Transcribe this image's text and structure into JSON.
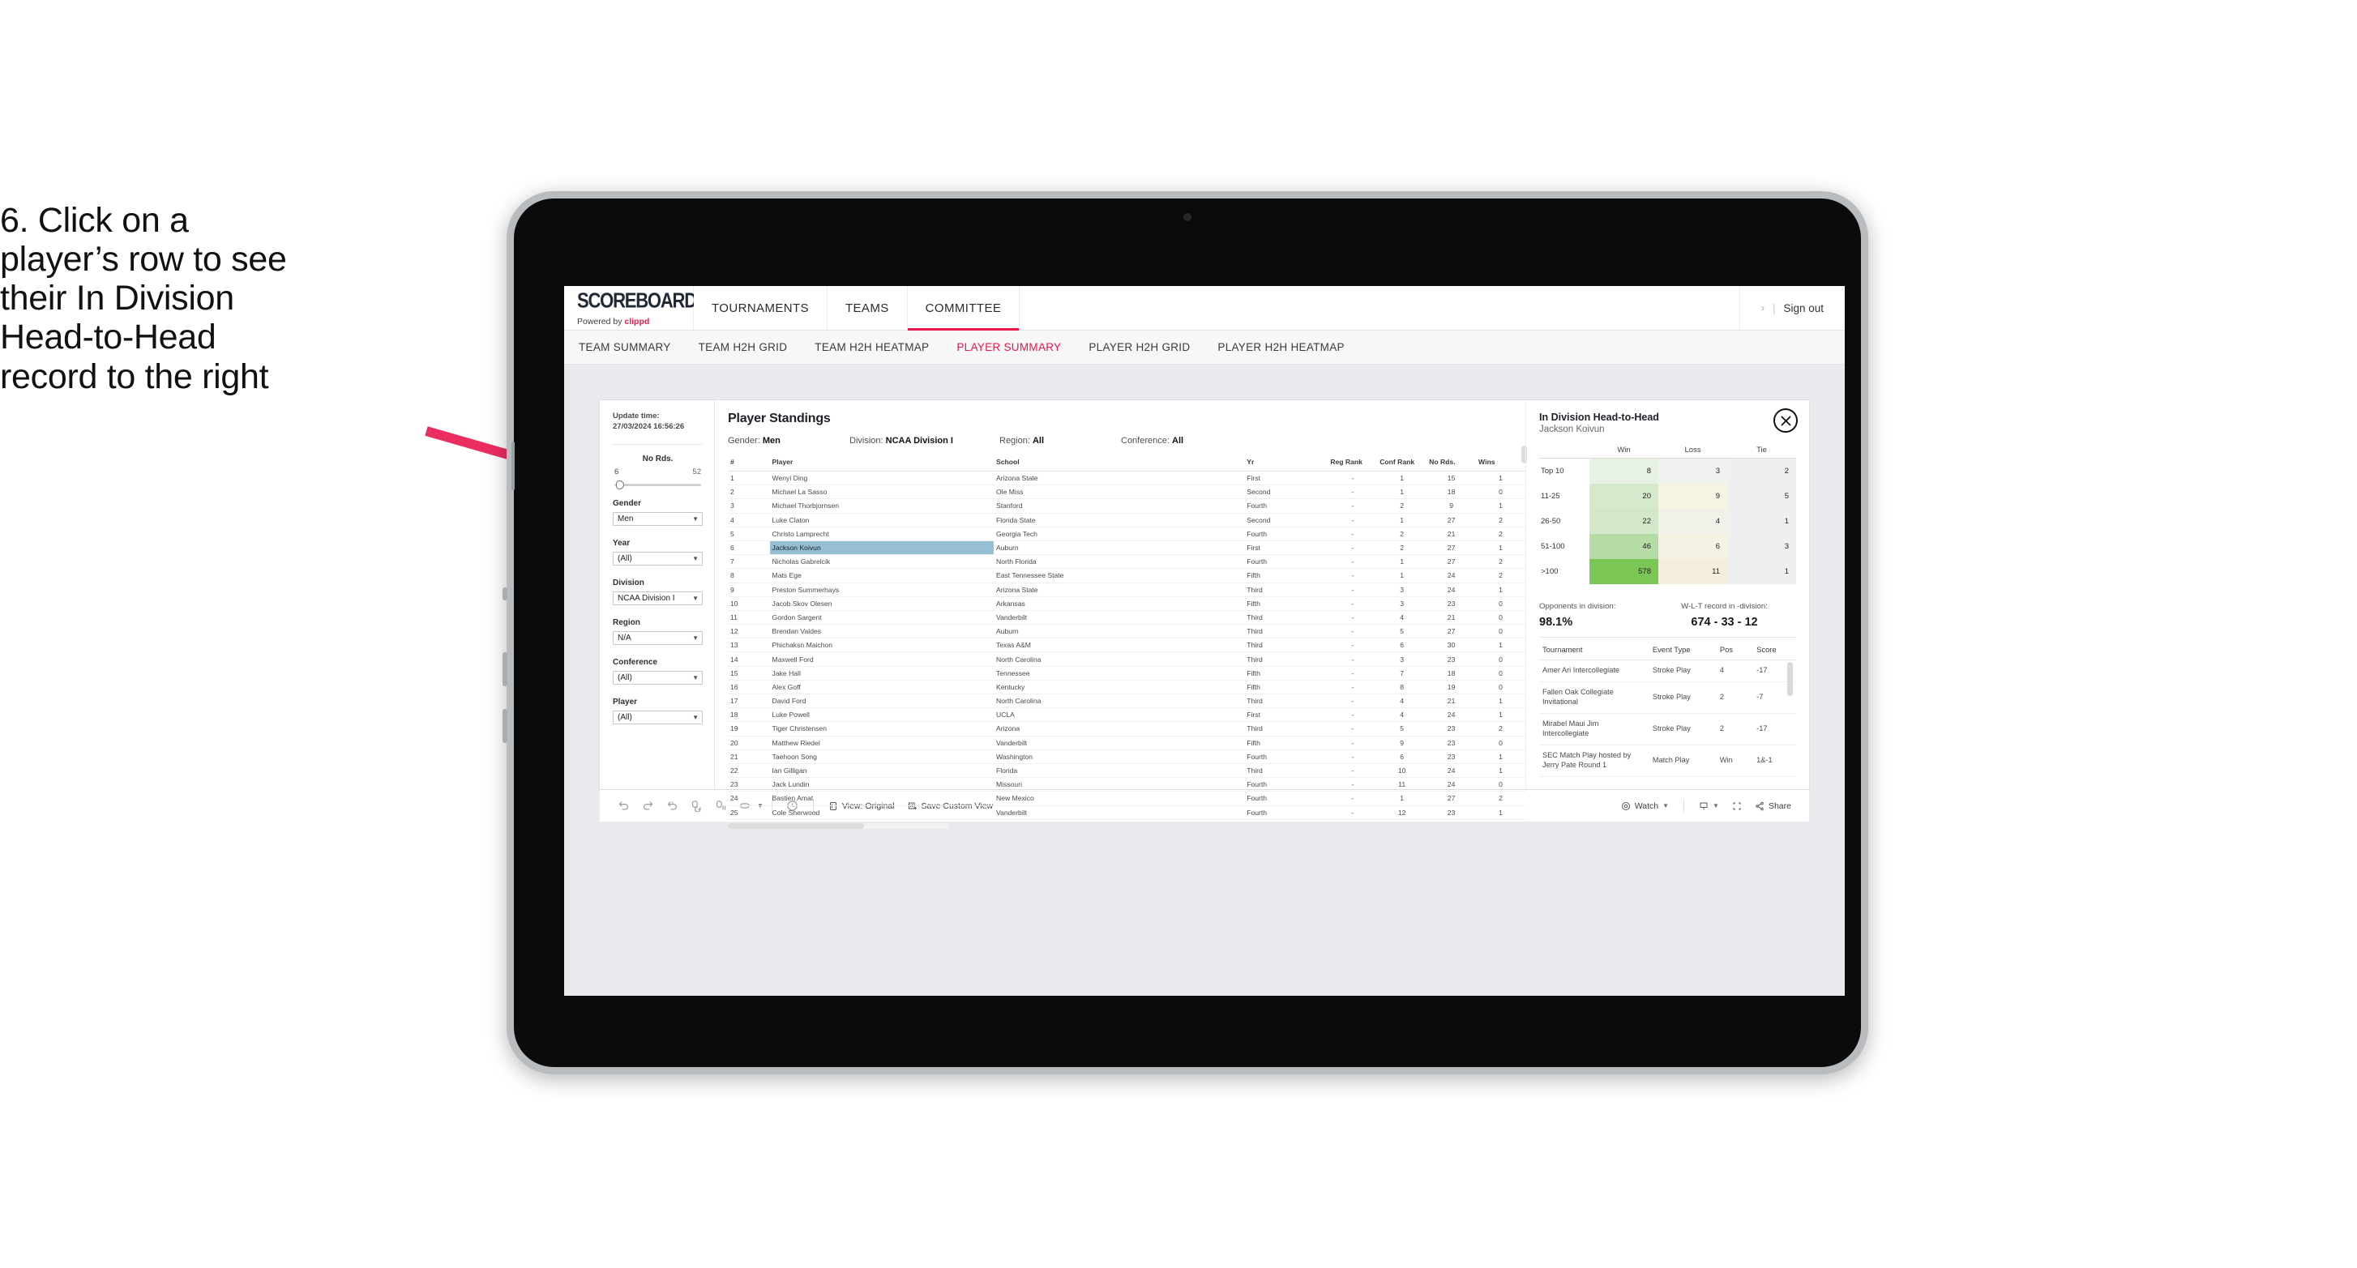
{
  "callout": {
    "lines": [
      "6. Click on a",
      "player’s row to see",
      "their In Division",
      "Head-to-Head",
      "record to the right"
    ]
  },
  "appbar": {
    "logo_main": "SCOREBOARD",
    "logo_sub_prefix": "Powered by ",
    "logo_sub_brand": "clippd",
    "nav": [
      {
        "label": "TOURNAMENTS",
        "active": false
      },
      {
        "label": "TEAMS",
        "active": false
      },
      {
        "label": "COMMITTEE",
        "active": true
      }
    ],
    "chevron": "›",
    "divider": "|",
    "sign_out": "Sign out"
  },
  "subnav": {
    "items": [
      {
        "label": "TEAM SUMMARY",
        "active": false
      },
      {
        "label": "TEAM H2H GRID",
        "active": false
      },
      {
        "label": "TEAM H2H HEATMAP",
        "active": false
      },
      {
        "label": "PLAYER SUMMARY",
        "active": true
      },
      {
        "label": "PLAYER H2H GRID",
        "active": false
      },
      {
        "label": "PLAYER H2H HEATMAP",
        "active": false
      }
    ]
  },
  "filters": {
    "update_label": "Update time:",
    "update_value": "27/03/2024 16:56:26",
    "slider": {
      "title": "No Rds.",
      "min": "6",
      "max": "52"
    },
    "selects": [
      {
        "title": "Gender",
        "value": "Men"
      },
      {
        "title": "Year",
        "value": "(All)"
      },
      {
        "title": "Division",
        "value": "NCAA Division I"
      },
      {
        "title": "Region",
        "value": "N/A"
      },
      {
        "title": "Conference",
        "value": "(All)"
      },
      {
        "title": "Player",
        "value": "(All)"
      }
    ]
  },
  "standings": {
    "title": "Player Standings",
    "meta": [
      {
        "label": "Gender:",
        "value": "Men"
      },
      {
        "label": "Division:",
        "value": "NCAA Division I"
      },
      {
        "label": "Region:",
        "value": "All"
      },
      {
        "label": "Conference:",
        "value": "All"
      }
    ],
    "columns": [
      "#",
      "Player",
      "School",
      "Yr",
      "Reg Rank",
      "Conf Rank",
      "No Rds.",
      "Wins"
    ],
    "rows": [
      {
        "n": "1",
        "player": "Wenyi Ding",
        "school": "Arizona State",
        "yr": "First",
        "reg": "-",
        "conf": "1",
        "rds": "15",
        "wins": "1",
        "selected": false
      },
      {
        "n": "2",
        "player": "Michael La Sasso",
        "school": "Ole Miss",
        "yr": "Second",
        "reg": "-",
        "conf": "1",
        "rds": "18",
        "wins": "0",
        "selected": false
      },
      {
        "n": "3",
        "player": "Michael Thorbjornsen",
        "school": "Stanford",
        "yr": "Fourth",
        "reg": "-",
        "conf": "2",
        "rds": "9",
        "wins": "1",
        "selected": false
      },
      {
        "n": "4",
        "player": "Luke Claton",
        "school": "Florida State",
        "yr": "Second",
        "reg": "-",
        "conf": "1",
        "rds": "27",
        "wins": "2",
        "selected": false
      },
      {
        "n": "5",
        "player": "Christo Lamprecht",
        "school": "Georgia Tech",
        "yr": "Fourth",
        "reg": "-",
        "conf": "2",
        "rds": "21",
        "wins": "2",
        "selected": false
      },
      {
        "n": "6",
        "player": "Jackson Koivun",
        "school": "Auburn",
        "yr": "First",
        "reg": "-",
        "conf": "2",
        "rds": "27",
        "wins": "1",
        "selected": true
      },
      {
        "n": "7",
        "player": "Nicholas Gabrelcik",
        "school": "North Florida",
        "yr": "Fourth",
        "reg": "-",
        "conf": "1",
        "rds": "27",
        "wins": "2",
        "selected": false
      },
      {
        "n": "8",
        "player": "Mats Ege",
        "school": "East Tennessee State",
        "yr": "Fifth",
        "reg": "-",
        "conf": "1",
        "rds": "24",
        "wins": "2",
        "selected": false
      },
      {
        "n": "9",
        "player": "Preston Summerhays",
        "school": "Arizona State",
        "yr": "Third",
        "reg": "-",
        "conf": "3",
        "rds": "24",
        "wins": "1",
        "selected": false
      },
      {
        "n": "10",
        "player": "Jacob Skov Olesen",
        "school": "Arkansas",
        "yr": "Fifth",
        "reg": "-",
        "conf": "3",
        "rds": "23",
        "wins": "0",
        "selected": false
      },
      {
        "n": "11",
        "player": "Gordon Sargent",
        "school": "Vanderbilt",
        "yr": "Third",
        "reg": "-",
        "conf": "4",
        "rds": "21",
        "wins": "0",
        "selected": false
      },
      {
        "n": "12",
        "player": "Brendan Valdes",
        "school": "Auburn",
        "yr": "Third",
        "reg": "-",
        "conf": "5",
        "rds": "27",
        "wins": "0",
        "selected": false
      },
      {
        "n": "13",
        "player": "Phichaksn Maichon",
        "school": "Texas A&M",
        "yr": "Third",
        "reg": "-",
        "conf": "6",
        "rds": "30",
        "wins": "1",
        "selected": false
      },
      {
        "n": "14",
        "player": "Maxwell Ford",
        "school": "North Carolina",
        "yr": "Third",
        "reg": "-",
        "conf": "3",
        "rds": "23",
        "wins": "0",
        "selected": false
      },
      {
        "n": "15",
        "player": "Jake Hall",
        "school": "Tennessee",
        "yr": "Fifth",
        "reg": "-",
        "conf": "7",
        "rds": "18",
        "wins": "0",
        "selected": false
      },
      {
        "n": "16",
        "player": "Alex Goff",
        "school": "Kentucky",
        "yr": "Fifth",
        "reg": "-",
        "conf": "8",
        "rds": "19",
        "wins": "0",
        "selected": false
      },
      {
        "n": "17",
        "player": "David Ford",
        "school": "North Carolina",
        "yr": "Third",
        "reg": "-",
        "conf": "4",
        "rds": "21",
        "wins": "1",
        "selected": false
      },
      {
        "n": "18",
        "player": "Luke Powell",
        "school": "UCLA",
        "yr": "First",
        "reg": "-",
        "conf": "4",
        "rds": "24",
        "wins": "1",
        "selected": false
      },
      {
        "n": "19",
        "player": "Tiger Christensen",
        "school": "Arizona",
        "yr": "Third",
        "reg": "-",
        "conf": "5",
        "rds": "23",
        "wins": "2",
        "selected": false
      },
      {
        "n": "20",
        "player": "Matthew Riedel",
        "school": "Vanderbilt",
        "yr": "Fifth",
        "reg": "-",
        "conf": "9",
        "rds": "23",
        "wins": "0",
        "selected": false
      },
      {
        "n": "21",
        "player": "Taehoon Song",
        "school": "Washington",
        "yr": "Fourth",
        "reg": "-",
        "conf": "6",
        "rds": "23",
        "wins": "1",
        "selected": false
      },
      {
        "n": "22",
        "player": "Ian Gilligan",
        "school": "Florida",
        "yr": "Third",
        "reg": "-",
        "conf": "10",
        "rds": "24",
        "wins": "1",
        "selected": false
      },
      {
        "n": "23",
        "player": "Jack Lundin",
        "school": "Missouri",
        "yr": "Fourth",
        "reg": "-",
        "conf": "11",
        "rds": "24",
        "wins": "0",
        "selected": false
      },
      {
        "n": "24",
        "player": "Bastien Amat",
        "school": "New Mexico",
        "yr": "Fourth",
        "reg": "-",
        "conf": "1",
        "rds": "27",
        "wins": "2",
        "selected": false
      },
      {
        "n": "25",
        "player": "Cole Sherwood",
        "school": "Vanderbilt",
        "yr": "Fourth",
        "reg": "-",
        "conf": "12",
        "rds": "23",
        "wins": "1",
        "selected": false
      }
    ]
  },
  "h2h": {
    "title": "In Division Head-to-Head",
    "player": "Jackson Koivun",
    "close_icon": "close-icon",
    "heatmap": {
      "columns": [
        "Win",
        "Loss",
        "Tie"
      ],
      "rows": [
        {
          "label": "Top 10",
          "win": "8",
          "loss": "3",
          "tie": "2",
          "win_color": "#e8f2e4",
          "loss_color": "#f0f0ee",
          "tie_color": "#efefef"
        },
        {
          "label": "11-25",
          "win": "20",
          "loss": "9",
          "tie": "5",
          "win_color": "#d6e9cd",
          "loss_color": "#f6f3e3",
          "tie_color": "#efefef"
        },
        {
          "label": "26-50",
          "win": "22",
          "loss": "4",
          "tie": "1",
          "win_color": "#d2e8c8",
          "loss_color": "#f2f1e9",
          "tie_color": "#efefef"
        },
        {
          "label": "51-100",
          "win": "46",
          "loss": "6",
          "tie": "3",
          "win_color": "#b6dca6",
          "loss_color": "#f5f2e4",
          "tie_color": "#efefef"
        },
        {
          "label": ">100",
          "win": "578",
          "loss": "11",
          "tie": "1",
          "win_color": "#7ac756",
          "loss_color": "#f3efdc",
          "tie_color": "#efefef"
        }
      ]
    },
    "kpis": [
      {
        "label": "Opponents in division:",
        "value": "98.1%"
      },
      {
        "label": "W-L-T record in -division:",
        "value": "674 - 33 - 12"
      }
    ],
    "tournaments": {
      "columns": [
        "Tournament",
        "Event Type",
        "Pos",
        "Score"
      ],
      "rows": [
        {
          "name": "Amer Ari Intercollegiate",
          "type": "Stroke Play",
          "pos": "4",
          "score": "-17"
        },
        {
          "name": "Fallen Oak Collegiate Invitational",
          "type": "Stroke Play",
          "pos": "2",
          "score": "-7"
        },
        {
          "name": "Mirabel Maui Jim Intercollegiate",
          "type": "Stroke Play",
          "pos": "2",
          "score": "-17"
        },
        {
          "name": "SEC Match Play hosted by Jerry Pate Round 1",
          "type": "Match Play",
          "pos": "Win",
          "score": "1&-1"
        }
      ]
    }
  },
  "toolbar": {
    "icons": [
      "undo-icon",
      "redo-icon",
      "revert-icon",
      "refresh-icon",
      "pause-icon",
      "rectangle-select-icon"
    ],
    "view_label": "View: Original",
    "save_label": "Save Custom View",
    "watch_label": "Watch",
    "share_label": "Share",
    "download_icon": "download-icon",
    "fullscreen_icon": "fullscreen-icon"
  },
  "colors": {
    "accent": "#e8174c",
    "selection": "#97c0d4",
    "arrow": "#ec2d62"
  }
}
